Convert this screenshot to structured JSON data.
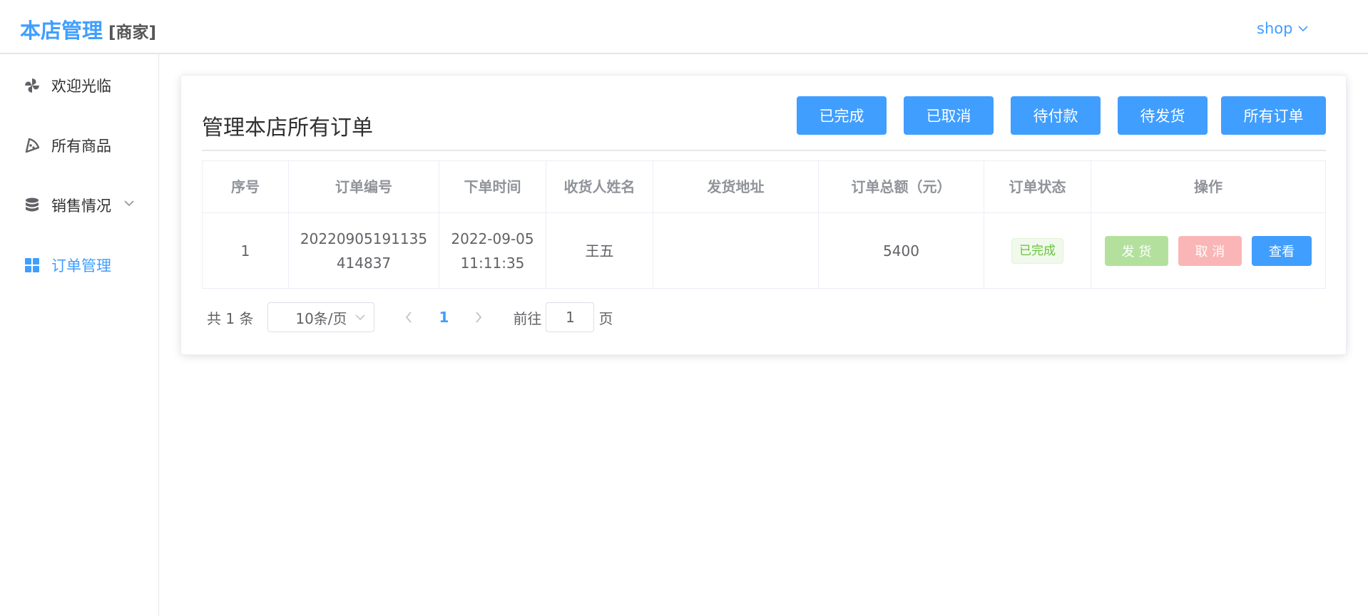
{
  "header": {
    "title": "本店管理",
    "tag": "[商家]",
    "user": "shop"
  },
  "sidebar": {
    "items": [
      {
        "label": "欢迎光临",
        "icon": "pinwheel-icon"
      },
      {
        "label": "所有商品",
        "icon": "pizza-icon"
      },
      {
        "label": "销售情况",
        "icon": "database-icon"
      },
      {
        "label": "订单管理",
        "icon": "grid-icon",
        "active": true
      }
    ]
  },
  "main": {
    "title": "管理本店所有订单",
    "filters": [
      "已完成",
      "已取消",
      "待付款",
      "待发货",
      "所有订单"
    ],
    "table": {
      "headers": [
        "序号",
        "订单编号",
        "下单时间",
        "收货人姓名",
        "发货地址",
        "订单总额（元）",
        "订单状态",
        "操作"
      ],
      "rows": [
        {
          "index": "1",
          "order_no_line1": "20220905191135",
          "order_no_line2": "414837",
          "date": "2022-09-05",
          "time": "11:11:35",
          "receiver": "王五",
          "address": "",
          "total": "5400",
          "status": "已完成",
          "actions": {
            "ship": "发 货",
            "cancel": "取 消",
            "view": "查看"
          }
        }
      ]
    },
    "pagination": {
      "total_text": "共 1 条",
      "page_size": "10条/页",
      "current_page": "1",
      "goto_label": "前往",
      "goto_value": "1",
      "goto_suffix": "页"
    }
  },
  "colors": {
    "primary": "#409eff",
    "success_light": "#b3e19d",
    "danger_light": "#fab6b6",
    "success_text": "#67c23a"
  }
}
